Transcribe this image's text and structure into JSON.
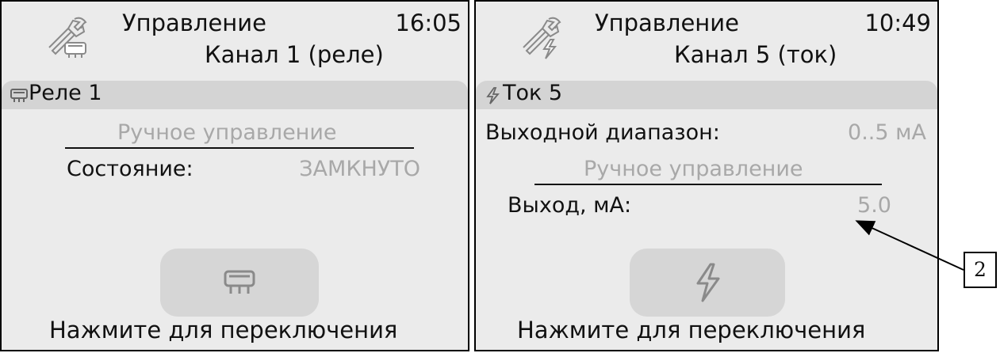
{
  "left_panel": {
    "title": "Управление",
    "time": "16:05",
    "channel": "Канал 1 (реле)",
    "section_label": "Реле 1",
    "section_icon": "relay-icon",
    "mode_label": "Ручное управление",
    "state_label": "Состояние:",
    "state_value": "ЗАМКНУТО",
    "toggle_icon": "relay-icon",
    "footer_text": "Нажмите для переключения"
  },
  "right_panel": {
    "title": "Управление",
    "time": "10:49",
    "channel": "Канал 5 (ток)",
    "section_label": "Ток 5",
    "section_icon": "lightning-icon",
    "range_label": "Выходной диапазон:",
    "range_value": "0..5 мА",
    "mode_label": "Ручное управление",
    "output_label": "Выход, мА:",
    "output_value": "5.0",
    "toggle_icon": "lightning-icon",
    "footer_text": "Нажмите для переключения"
  },
  "callout": {
    "label": "2"
  },
  "colors": {
    "panel_bg": "#ebebeb",
    "section_bar": "#d4d4d4",
    "muted_text": "#a8a8a8",
    "button_bg": "#d6d6d6"
  }
}
